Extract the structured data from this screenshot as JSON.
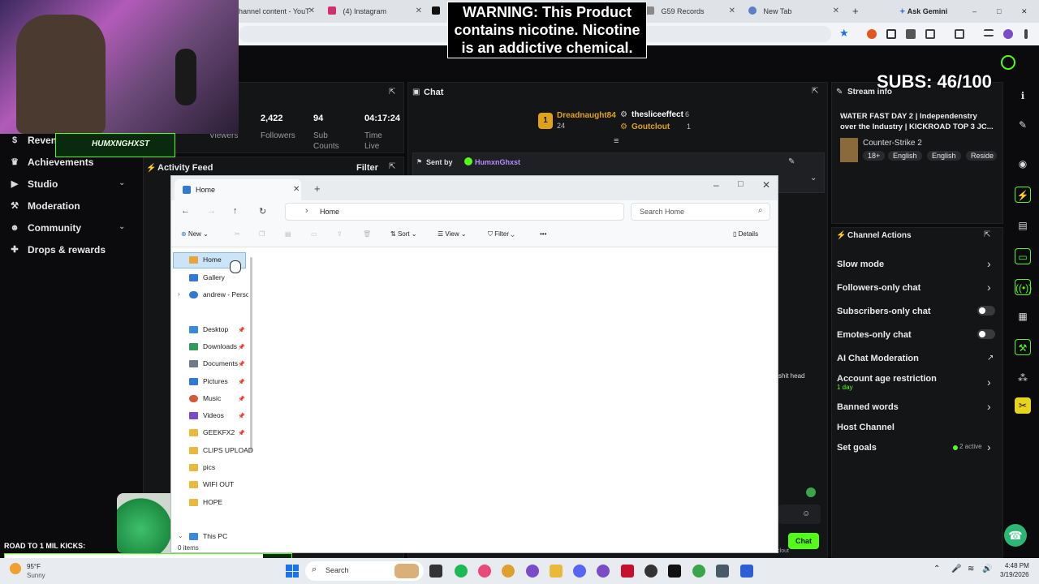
{
  "browser": {
    "tabs": [
      {
        "title": "hannel content - YouT"
      },
      {
        "title": "(4) Instagram"
      },
      {
        "title": "G59 Records"
      },
      {
        "title": "New Tab"
      }
    ],
    "ask_gemini": "Ask Gemini",
    "new_tab_glyph": "+"
  },
  "warning": {
    "line1": "WARNING: This Product",
    "line2": "contains nicotine. Nicotine",
    "line3": "is an addictive chemical."
  },
  "stream_overlay": {
    "subs": "SUBS: 46/100",
    "road": "ROAD TO 1 MIL KICKS:",
    "logo_name": "HUMXNGHXST"
  },
  "sidebar": {
    "items": [
      {
        "label": "Reven",
        "icon": "dollar-icon"
      },
      {
        "label": "Achievements",
        "icon": "trophy-icon"
      },
      {
        "label": "Studio",
        "icon": "camera-icon"
      },
      {
        "label": "Moderation",
        "icon": "hammer-icon"
      },
      {
        "label": "Community",
        "icon": "people-icon"
      },
      {
        "label": "Drops & rewards",
        "icon": "gift-icon"
      }
    ]
  },
  "stats": {
    "viewers_label": "Viewers",
    "followers_value": "2,422",
    "followers_label": "Followers",
    "subs_value": "94",
    "subs_label_1": "Sub",
    "subs_label_2": "Counts",
    "time_value": "04:17:24",
    "time_label_1": "Time",
    "time_label_2": "Live"
  },
  "activity_feed": {
    "title": "Activity Feed",
    "filter": "Filter"
  },
  "chat": {
    "title": "Chat",
    "leaders": [
      {
        "rank": "1",
        "name": "Dreadnaught84",
        "count": "24"
      },
      {
        "name": "thesliceeffect",
        "count": "6"
      },
      {
        "name": "Goutclout",
        "count": "1"
      }
    ],
    "pinned_by_label": "Sent by",
    "pinned_by_user": "HumxnGhxst",
    "side_text": "shit head",
    "chat_button": "Chat",
    "footer_user": "Goutclout"
  },
  "stream_info": {
    "title": "Stream info",
    "stream_title": "WATER FAST DAY 2 | Independenstry over the Industry | KICKROAD TOP 3 JC...",
    "category": "Counter-Strike 2",
    "tags": [
      "18+",
      "English",
      "English",
      "Reside"
    ]
  },
  "channel_actions": {
    "title": "Channel Actions",
    "items": [
      {
        "label": "Slow mode",
        "control": "arrow"
      },
      {
        "label": "Followers-only chat",
        "control": "arrow"
      },
      {
        "label": "Subscribers-only chat",
        "control": "toggle"
      },
      {
        "label": "Emotes-only chat",
        "control": "toggle"
      },
      {
        "label": "AI Chat Moderation",
        "control": "external"
      },
      {
        "label": "Account age restriction",
        "sub": "1 day",
        "control": "arrow"
      },
      {
        "label": "Banned words",
        "control": "arrow"
      },
      {
        "label": "Host Channel",
        "control": "none"
      },
      {
        "label": "Set goals",
        "sub_right": "2 active",
        "control": "arrow"
      }
    ]
  },
  "explorer": {
    "tab_title": "Home",
    "breadcrumb": "Home",
    "search_placeholder": "Search Home",
    "commands": {
      "new": "New",
      "sort": "Sort",
      "view": "View",
      "filter": "Filter",
      "more": "•••",
      "details": "Details"
    },
    "nav": [
      {
        "label": "Home",
        "selected": true,
        "color": "#e8a33c"
      },
      {
        "label": "Gallery",
        "color": "#2f7bd4"
      },
      {
        "label": "andrew - Persor",
        "color": "#2f7bd4"
      },
      {
        "label": "Desktop",
        "color": "#3b8ad9",
        "pinned": true
      },
      {
        "label": "Downloads",
        "color": "#2f9a5b",
        "pinned": true
      },
      {
        "label": "Documents",
        "color": "#6c7a89",
        "pinned": true
      },
      {
        "label": "Pictures",
        "color": "#2f7bd4",
        "pinned": true
      },
      {
        "label": "Music",
        "color": "#d45a3a",
        "pinned": true
      },
      {
        "label": "Videos",
        "color": "#7a4cc7",
        "pinned": true
      },
      {
        "label": "GEEKFX2",
        "color": "#e8b93c",
        "pinned": true
      },
      {
        "label": "CLIPS UPLOAD",
        "color": "#e8b93c"
      },
      {
        "label": "pics",
        "color": "#e8b93c"
      },
      {
        "label": "WIFI OUT",
        "color": "#e8b93c"
      },
      {
        "label": "HOPE",
        "color": "#e8b93c"
      },
      {
        "label": "This PC",
        "color": "#3b8ad9"
      }
    ],
    "status": "0 items"
  },
  "taskbar": {
    "weather_temp": "95°F",
    "weather_desc": "Sunny",
    "search": "Search",
    "time": "4:48 PM",
    "date": "3/19/2026"
  }
}
